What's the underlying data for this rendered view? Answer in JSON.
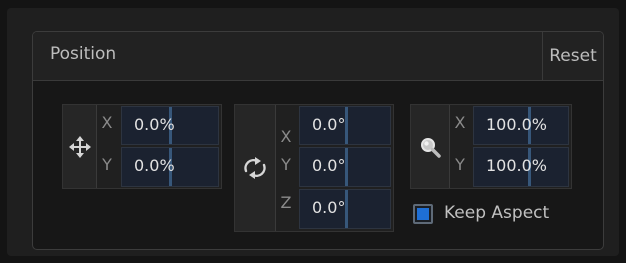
{
  "panel": {
    "title": "Position",
    "reset_label": "Reset"
  },
  "translate": {
    "icon": "move-arrows-icon",
    "x": {
      "axis": "X",
      "value": "0.0%"
    },
    "y": {
      "axis": "Y",
      "value": "0.0%"
    }
  },
  "rotate": {
    "icon": "rotate-arrows-icon",
    "x": {
      "axis": "X",
      "value": "0.0°"
    },
    "y": {
      "axis": "Y",
      "value": "0.0°"
    },
    "z": {
      "axis": "Z",
      "value": "0.0°"
    }
  },
  "scale": {
    "icon": "magnifier-icon",
    "x": {
      "axis": "X",
      "value": "100.0%"
    },
    "y": {
      "axis": "Y",
      "value": "100.0%"
    }
  },
  "keep_aspect": {
    "label": "Keep Aspect",
    "checked": true
  },
  "colors": {
    "accent": "#1e6fd6",
    "field_bg": "#1b2230",
    "text": "#e2e2e2"
  }
}
